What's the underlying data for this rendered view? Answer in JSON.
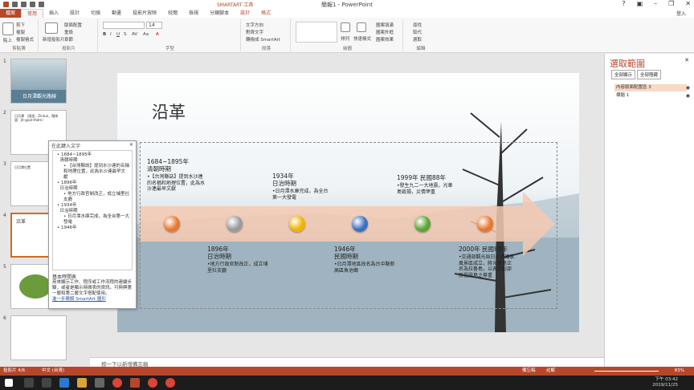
{
  "window": {
    "title": "簡報1 - PowerPoint",
    "context_tool": "SMARTART 工具",
    "user": "登入"
  },
  "tabs": [
    "檔案",
    "常用",
    "插入",
    "設計",
    "切換",
    "動畫",
    "投影片放映",
    "校閱",
    "檢視",
    "分鏡腳本",
    "設計",
    "格式"
  ],
  "ribbon": {
    "clipboard": {
      "paste": "貼上",
      "cut": "剪下",
      "copy": "複製",
      "format_painter": "複製格式",
      "group": "剪貼簿"
    },
    "slides": {
      "new_slide": "新增投影片",
      "layout": "版面配置",
      "reset": "重設",
      "section": "章節",
      "group": "投影片"
    },
    "font": {
      "size": "14",
      "group": "字型"
    },
    "paragraph": {
      "text_direction": "文字方向",
      "align_text": "對齊文字",
      "smartart": "轉換成 SmartArt",
      "group": "段落"
    },
    "drawing": {
      "arrange": "排列",
      "quick_styles": "快速樣式",
      "shape_fill": "圖案填滿",
      "shape_outline": "圖案外框",
      "shape_effects": "圖案效果",
      "group": "繪圖"
    },
    "editing": {
      "find": "尋找",
      "replace": "取代",
      "select": "選取",
      "group": "編輯"
    }
  },
  "thumbnails": [
    {
      "num": "1",
      "text": "日月潭觀光路線"
    },
    {
      "num": "2",
      "text": "日月潭 （邵語：Zintun，閩南語：Jit-goat-thâm）"
    },
    {
      "num": "3",
      "text": "日月潭位置"
    },
    {
      "num": "4",
      "text": "沿革"
    },
    {
      "num": "5",
      "text": ""
    },
    {
      "num": "6",
      "text": ""
    }
  ],
  "slide": {
    "title": "沿革",
    "events": [
      {
        "year": "1684~1895年",
        "era": "清朝時期",
        "desc": "•【台灣縣誌】提到水沙連的名稱和地理位置，此為水沙連最早文獻"
      },
      {
        "year": "1896年",
        "era": "日治時期",
        "desc": "•地方行政官制改正，成立埔里社支廳"
      },
      {
        "year": "1934年",
        "era": "日治時期",
        "desc": "•日月潭水庫完成，為全台第一大發電"
      },
      {
        "year": "1946年",
        "era": "民國時期",
        "desc": "•日月潭地區改名為台中縣新高區魚池鄉"
      },
      {
        "year": "1999年 民國88年",
        "era": "",
        "desc": "•發生九二一大地震，光華島毀損，災情慘重"
      },
      {
        "year": "2000年 民國89年",
        "era": "",
        "desc": "•交通部觀光局日月潭國家風景區成立，將光華島正名為拉魯島，以表示對邵族祖靈島之尊重"
      }
    ],
    "dot_colors": [
      "#e8772e",
      "#9a9a9a",
      "#f0b400",
      "#3a6fc4",
      "#5aa532",
      "#e8772e"
    ]
  },
  "text_pane": {
    "title": "在此鍵入文字",
    "items": [
      {
        "level": 1,
        "text": "1684~1895年"
      },
      {
        "level": 1,
        "text": "清朝時期"
      },
      {
        "level": 2,
        "text": "【台灣縣誌】提到水沙連的名稱和地理位置，此為水沙連最早文獻"
      },
      {
        "level": 1,
        "text": "1896年"
      },
      {
        "level": 1,
        "text": "日治時期"
      },
      {
        "level": 2,
        "text": "地方行政官制改正，成立埔里社支廳"
      },
      {
        "level": 1,
        "text": "1934年"
      },
      {
        "level": 1,
        "text": "日治時期"
      },
      {
        "level": 2,
        "text": "日月潭水庫完成，為全台第一大發電"
      },
      {
        "level": 1,
        "text": "1946年"
      }
    ],
    "footer_title": "基本時間表",
    "footer_desc": "用來顯示工作、程序或工作流程的連續步驟，或者是顯示時間表的資訊。可與興第一層和第二層文字搭配使用。",
    "footer_link": "進一步瞭解 SmartArt 圖形"
  },
  "selection_pane": {
    "title": "選取範圍",
    "show_all": "全部顯示",
    "hide_all": "全部隱藏",
    "items": [
      "內容版面配置區 3",
      "標題 1"
    ]
  },
  "notes": "按一下以新增備忘稿",
  "status": {
    "slide": "投影片 4/6",
    "lang": "中文 (台灣)",
    "notes_btn": "備忘稿",
    "comments_btn": "註解",
    "zoom": "83%"
  },
  "clock": {
    "time": "下午 03:42",
    "date": "2019/11/25"
  }
}
